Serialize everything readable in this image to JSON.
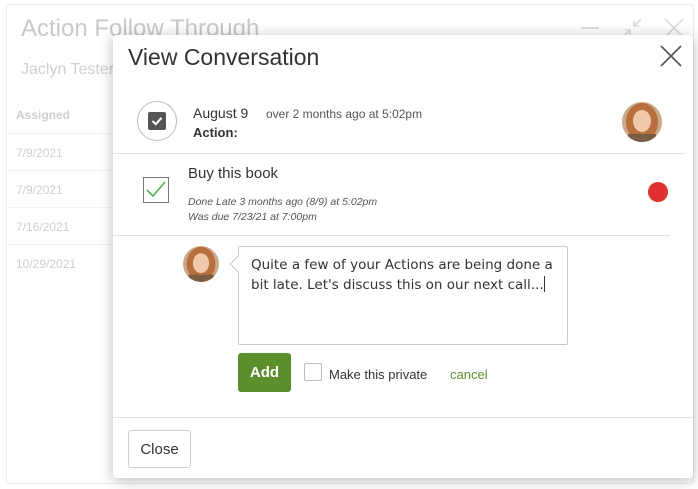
{
  "background": {
    "title": "Action Follow Through",
    "subtitle": "Jaclyn Tester",
    "column_header": "Assigned",
    "rows": [
      "7/9/2021",
      "7/9/2021",
      "7/16/2021",
      "10/29/2021"
    ]
  },
  "modal": {
    "title": "View Conversation",
    "header": {
      "date": "August 9",
      "meta": "over 2 months ago at 5:02pm",
      "action_label": "Action:"
    },
    "action": {
      "title": "Buy this book",
      "done_text": "Done Late 3 months ago (8/9) at 5:02pm",
      "due_text": "Was due 7/23/21 at 7:00pm",
      "status_color": "#e03131"
    },
    "comment": {
      "text": "Quite a few of your Actions are being done a bit late.  Let's discuss this on our next call..."
    },
    "buttons": {
      "add_label": "Add",
      "private_label": "Make this private",
      "cancel_label": "cancel",
      "close_label": "Close"
    }
  },
  "colors": {
    "accent_green": "#5b8f2e",
    "check_green": "#4caf50"
  },
  "icons": [
    "close-icon",
    "minimize-icon",
    "shrink-icon",
    "checkbox-icon",
    "checkmark-icon",
    "avatar"
  ]
}
